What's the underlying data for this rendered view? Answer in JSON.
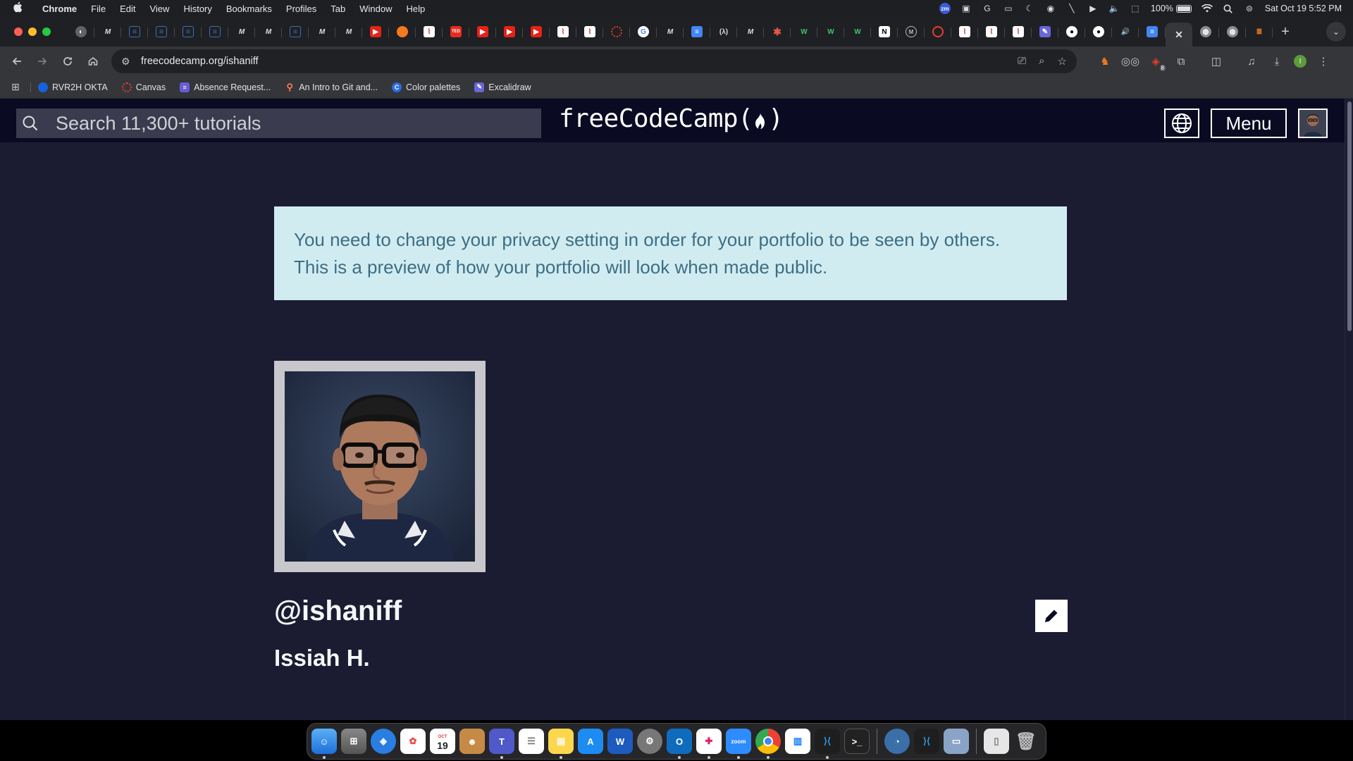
{
  "menubar": {
    "app_name": "Chrome",
    "items": [
      "File",
      "Edit",
      "View",
      "History",
      "Bookmarks",
      "Profiles",
      "Tab",
      "Window",
      "Help"
    ],
    "battery": "100%",
    "datetime": "Sat Oct 19  5:52 PM"
  },
  "browser": {
    "url": "freecodecamp.org/ishaniff",
    "bookmarks": [
      {
        "label": "RVR2H OKTA",
        "icon": "okta-icon",
        "color": "#1662dd"
      },
      {
        "label": "Canvas",
        "icon": "canvas-icon",
        "color": "#e13f2b"
      },
      {
        "label": "Absence Request...",
        "icon": "list-icon",
        "color": "#6b5bd6"
      },
      {
        "label": "An Intro to Git and...",
        "icon": "hubspot-icon",
        "color": "#ff7a59"
      },
      {
        "label": "Color palettes",
        "icon": "coolors-icon",
        "color": "#2c6be0"
      },
      {
        "label": "Excalidraw",
        "icon": "excalidraw-icon",
        "color": "#6965db"
      }
    ],
    "profile_initial": "I",
    "extension_badge": "8"
  },
  "fcc": {
    "search_placeholder": "Search 11,300+ tutorials",
    "logo_text_left": "freeCodeCamp(",
    "logo_text_right": ")",
    "menu_label": "Menu",
    "alert_line1": "You need to change your privacy setting in order for your portfolio to be seen by others.",
    "alert_line2": "This is a preview of how your portfolio will look when made public.",
    "username": "@ishaniff",
    "real_name": "Issiah H."
  },
  "colors": {
    "page_bg": "#1b1b32",
    "nav_bg": "#0a0a23",
    "alert_bg": "#d1ecf1",
    "alert_text": "#3d6e85"
  },
  "dock": {
    "calendar_day": "19",
    "calendar_month": "OCT"
  }
}
